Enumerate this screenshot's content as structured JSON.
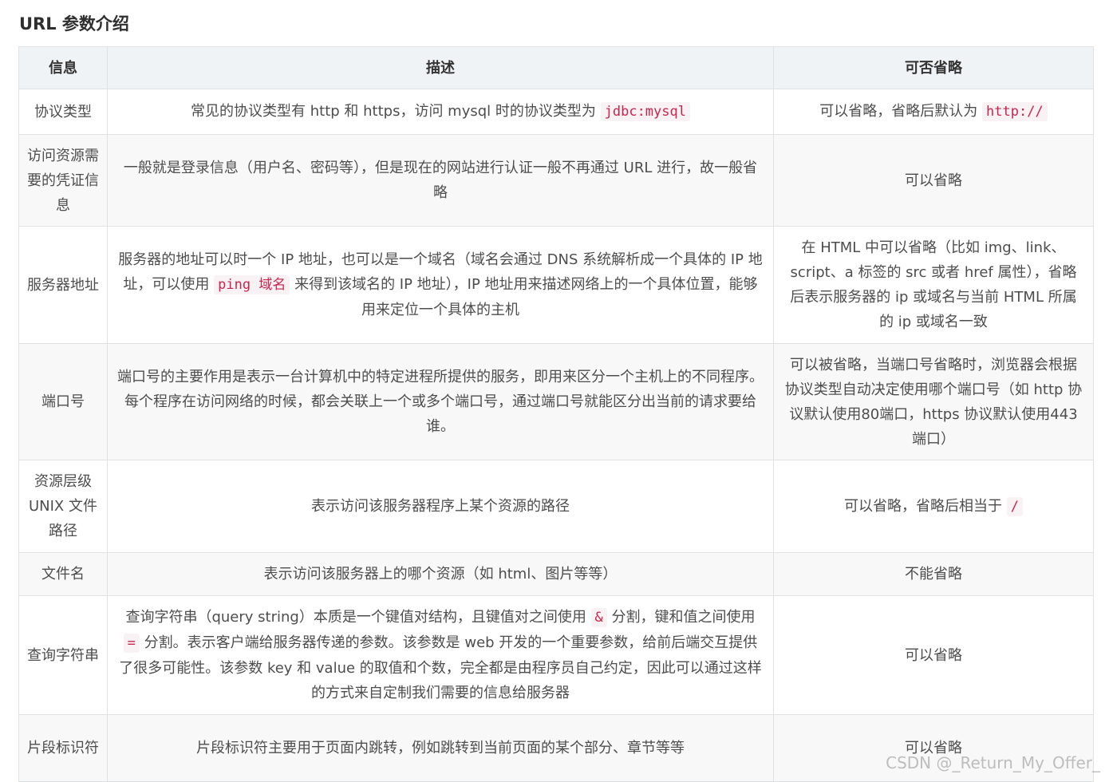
{
  "title": "URL 参数介绍",
  "headers": [
    "信息",
    "描述",
    "可否省略"
  ],
  "rows": [
    {
      "name": "协议类型",
      "desc": {
        "before": "常见的协议类型有 http 和 https，访问 mysql 时的协议类型为 ",
        "code": "jdbc:mysql",
        "after": ""
      },
      "omit": {
        "before": "可以省略，省略后默认为 ",
        "code": "http://",
        "after": ""
      }
    },
    {
      "name": "访问资源需要的凭证信息",
      "desc": {
        "before": "一般就是登录信息（用户名、密码等），但是现在的网站进行认证一般不再通过 URL 进行，故一般省略"
      },
      "omit": {
        "before": "可以省略"
      }
    },
    {
      "name": "服务器地址",
      "desc": {
        "before": "服务器的地址可以时一个 IP 地址，也可以是一个域名（域名会通过 DNS 系统解析成一个具体的 IP 地址，可以使用 ",
        "code": "ping 域名",
        "after": " 来得到该域名的 IP 地址），IP 地址用来描述网络上的一个具体位置，能够用来定位一个具体的主机"
      },
      "omit": {
        "before": "在 HTML 中可以省略（比如 img、link、script、a 标签的 src 或者 href 属性），省略后表示服务器的 ip 或域名与当前 HTML 所属的 ip 或域名一致"
      }
    },
    {
      "name": "端口号",
      "desc": {
        "before": "端口号的主要作用是表示一台计算机中的特定进程所提供的服务，即用来区分一个主机上的不同程序。每个程序在访问网络的时候，都会关联上一个或多个端口号，通过端口号就能区分出当前的请求要给谁。"
      },
      "omit": {
        "before": "可以被省略，当端口号省略时，浏览器会根据协议类型自动决定使用哪个端口号（如 http 协议默认使用80端口，https 协议默认使用443端口）"
      }
    },
    {
      "name": "资源层级 UNIX 文件路径",
      "desc": {
        "before": "表示访问该服务器程序上某个资源的路径"
      },
      "omit": {
        "before": "可以省略，省略后相当于 ",
        "code": "/",
        "after": ""
      }
    },
    {
      "name": "文件名",
      "desc": {
        "before": "表示访问该服务器上的哪个资源（如 html、图片等等）"
      },
      "omit": {
        "before": "不能省略"
      }
    },
    {
      "name": "查询字符串",
      "desc": {
        "before": "查询字符串（query string）本质是一个键值对结构，且键值对之间使用 ",
        "code": "&",
        "mid": " 分割，键和值之间使用 ",
        "code2": "=",
        "after": " 分割。表示客户端给服务器传递的参数。该参数是 web 开发的一个重要参数，给前后端交互提供了很多可能性。该参数 key 和 value 的取值和个数，完全都是由程序员自己约定，因此可以通过这样的方式来自定制我们需要的信息给服务器"
      },
      "omit": {
        "before": "可以省略"
      }
    },
    {
      "name": "片段标识符",
      "desc": {
        "before": "片段标识符主要用于页面内跳转，例如跳转到当前页面的某个部分、章节等等"
      },
      "omit": {
        "before": "可以省略"
      }
    }
  ],
  "watermark": "CSDN @_Return_My_Offer_"
}
